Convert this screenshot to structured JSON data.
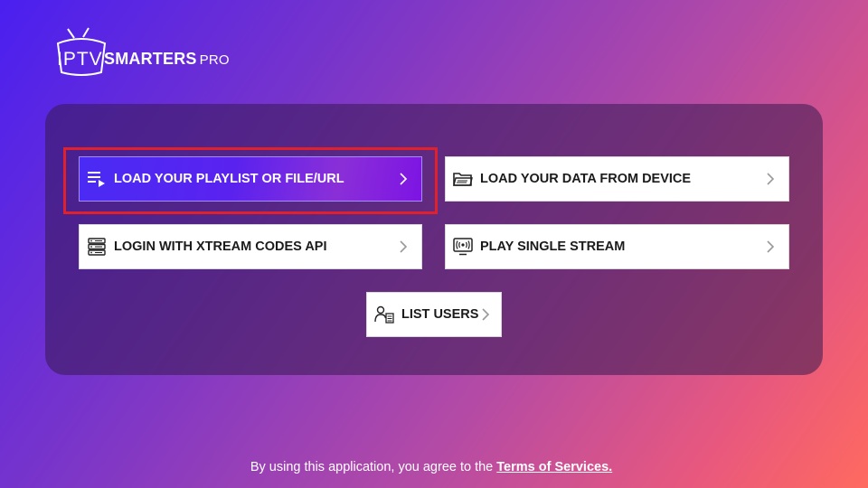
{
  "logo": {
    "iptv": "IPTV",
    "smarters": "SMARTERS",
    "pro": "PRO"
  },
  "buttons": {
    "load_playlist": "LOAD YOUR PLAYLIST OR FILE/URL",
    "load_device": "LOAD YOUR DATA FROM DEVICE",
    "login_xtream": "LOGIN WITH XTREAM CODES API",
    "play_single": "PLAY SINGLE STREAM",
    "list_users": "LIST USERS"
  },
  "icons": {
    "load_playlist": "playlist-icon",
    "load_device": "folder-icon",
    "login_xtream": "server-icon",
    "play_single": "broadcast-tv-icon",
    "list_users": "users-list-icon",
    "chevron": "chevron-right-icon"
  },
  "colors": {
    "active_button": "#5a22ef",
    "focus_ring": "#e0202a"
  },
  "footer": {
    "text": "By using this application, you agree to the",
    "link": "Terms of Services."
  }
}
